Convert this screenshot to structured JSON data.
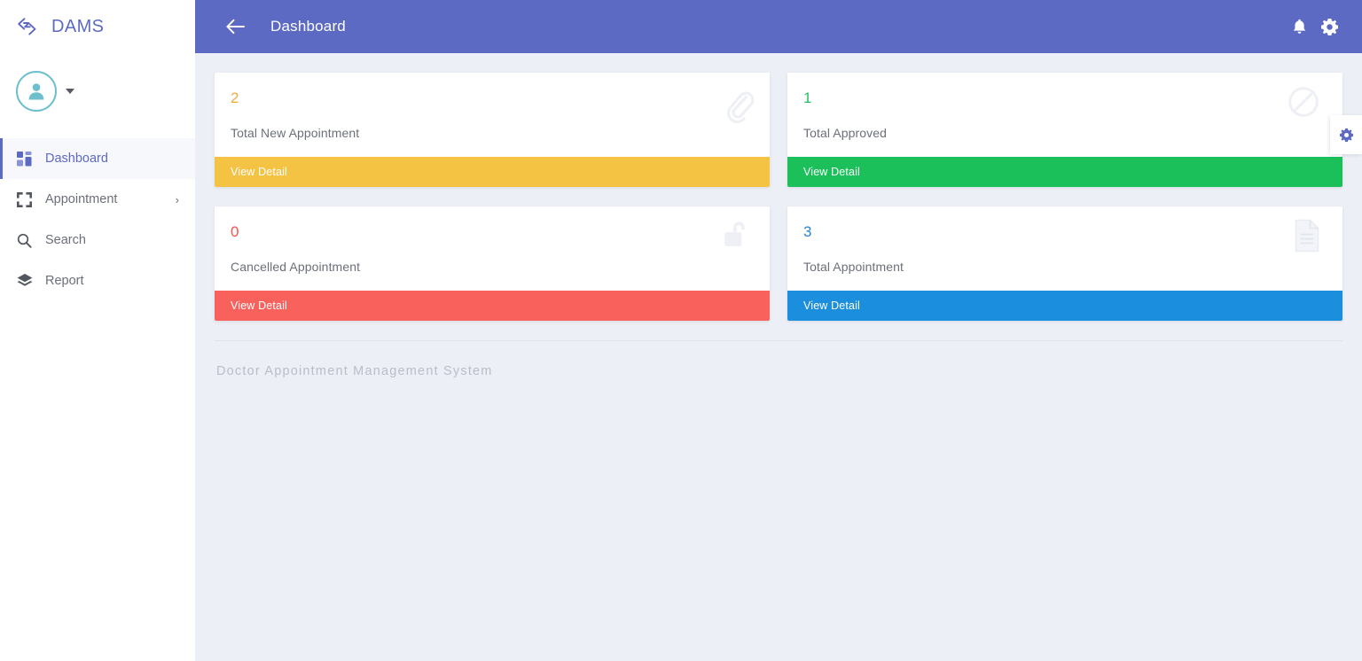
{
  "brand": {
    "name": "DAMS",
    "icon": "code-brackets-icon"
  },
  "sidebar": {
    "profile": {
      "avatar_icon": "user-avatar-icon",
      "caret_icon": "caret-down-icon"
    },
    "items": [
      {
        "label": "Dashboard",
        "icon": "grid-dashboard-icon",
        "active": true,
        "chevron": ""
      },
      {
        "label": "Appointment",
        "icon": "expand-arrows-icon",
        "active": false,
        "chevron": "›"
      },
      {
        "label": "Search",
        "icon": "search-icon",
        "active": false,
        "chevron": ""
      },
      {
        "label": "Report",
        "icon": "layers-icon",
        "active": false,
        "chevron": ""
      }
    ]
  },
  "topbar": {
    "back_icon": "arrow-left-icon",
    "title": "Dashboard",
    "notification_icon": "bell-icon",
    "settings_icon": "gear-icon"
  },
  "float_settings": {
    "icon": "gear-icon"
  },
  "cards": [
    {
      "value": "2",
      "label": "Total New Appointment",
      "action": "View Detail",
      "color": "#f5c councils"
    }
  ],
  "stat_cards": [
    {
      "value": "2",
      "label": "Total New Appointment",
      "action": "View Detail",
      "color": "#f5c344",
      "icon": "paperclip-icon"
    },
    {
      "value": "1",
      "label": "Total Approved",
      "action": "View Detail",
      "color": "#1bc05a",
      "icon": "ban-circle-slash-icon"
    },
    {
      "value": "0",
      "label": "Cancelled Appointment",
      "action": "View Detail",
      "color": "#f9615c",
      "icon": "unlock-padlock-icon"
    },
    {
      "value": "3",
      "label": "Total Appointment",
      "action": "View Detail",
      "color": "#1b8fdd",
      "icon": "document-file-icon"
    }
  ],
  "footer": {
    "text": "Doctor Appointment Management System"
  },
  "theme": {
    "primary": "#5c6ac4",
    "page_bg": "#eceff5",
    "sidebar_bg": "#ffffff",
    "avatar_ring": "#6ebfce"
  }
}
